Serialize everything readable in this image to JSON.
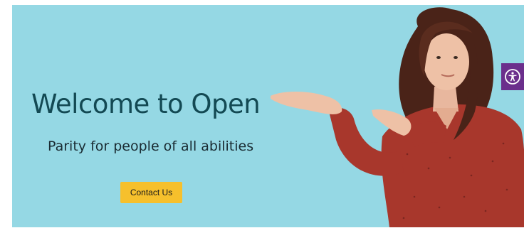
{
  "hero": {
    "title": "Welcome to Open",
    "subtitle": "Parity for people of all abilities",
    "cta_label": "Contact Us",
    "background_color": "#95d8e4",
    "title_color": "#134953",
    "button_color": "#f6c02c"
  },
  "accessibility_widget": {
    "icon": "accessibility-person-icon",
    "color": "#6b2f8c"
  },
  "hero_image": {
    "icon": "person-pointing-photo"
  }
}
